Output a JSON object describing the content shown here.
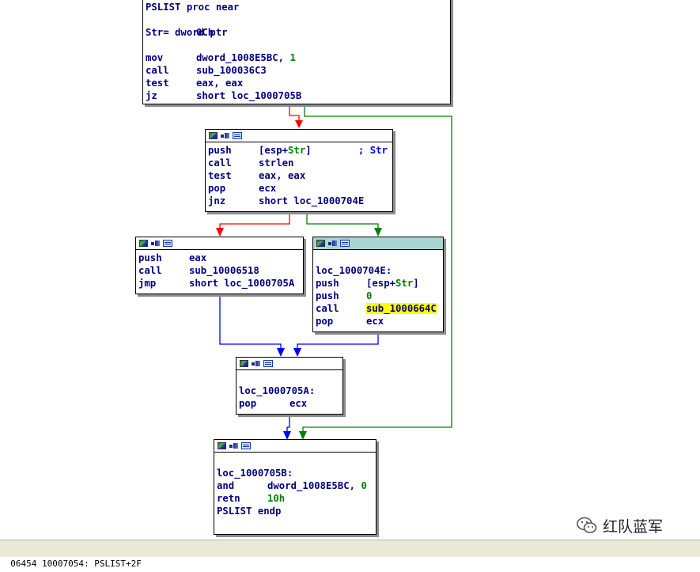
{
  "nodes": {
    "entry": {
      "lines": [
        {
          "mn": "PSLIST proc near",
          "op": ""
        },
        {
          "mn": "",
          "op": ""
        },
        {
          "mn": "Str= dword ptr  ",
          "op": "0Ch"
        },
        {
          "mn": "",
          "op": ""
        },
        {
          "mn": "mov",
          "op": "dword_1008E5BC, ",
          "num": "1"
        },
        {
          "mn": "call",
          "op": "sub_100036C3"
        },
        {
          "mn": "test",
          "op": "eax, eax"
        },
        {
          "mn": "jz",
          "op": "short loc_1000705B"
        }
      ]
    },
    "b2": {
      "lines": [
        {
          "mn": "push",
          "op": "[esp+",
          "var": "Str",
          "op2": "]",
          "cmt": "        ; Str"
        },
        {
          "mn": "call",
          "op": "strlen"
        },
        {
          "mn": "test",
          "op": "eax, eax"
        },
        {
          "mn": "pop",
          "op": "ecx"
        },
        {
          "mn": "jnz",
          "op": "short loc_1000704E"
        }
      ]
    },
    "b3": {
      "lines": [
        {
          "mn": "push",
          "op": "eax"
        },
        {
          "mn": "call",
          "op": "sub_10006518"
        },
        {
          "mn": "jmp",
          "op": "short loc_1000705A"
        }
      ]
    },
    "b4": {
      "lines": [
        {
          "mn": "",
          "op": ""
        },
        {
          "mn": "loc_1000704E:",
          "op": ""
        },
        {
          "mn": "push",
          "op": "[esp+",
          "var": "Str",
          "op2": "]"
        },
        {
          "mn": "push",
          "op": "",
          "num": "0"
        },
        {
          "mn": "call",
          "op": "",
          "hl": "sub_1000664C"
        },
        {
          "mn": "pop",
          "op": "ecx"
        }
      ]
    },
    "b5": {
      "lines": [
        {
          "mn": "",
          "op": ""
        },
        {
          "mn": "loc_1000705A:",
          "op": ""
        },
        {
          "mn": "pop",
          "op": "ecx"
        }
      ]
    },
    "b6": {
      "lines": [
        {
          "mn": "",
          "op": ""
        },
        {
          "mn": "loc_1000705B:",
          "op": ""
        },
        {
          "mn": "and",
          "op": "dword_1008E5BC, ",
          "num": "0"
        },
        {
          "mn": "retn",
          "op": "",
          "num": "10h"
        },
        {
          "mn": "PSLIST endp",
          "op": ""
        }
      ]
    }
  },
  "status_text": "06454 10007054: PSLIST+2F",
  "watermark": {
    "text": "红队蓝军"
  },
  "colors": {
    "true_edge": "#008000",
    "false_edge": "#ff0000",
    "jump_edge": "#0000ff",
    "code": "#000080",
    "number": "#008000",
    "highlight": "#ffff00",
    "active_header": "#a9d6d3"
  }
}
